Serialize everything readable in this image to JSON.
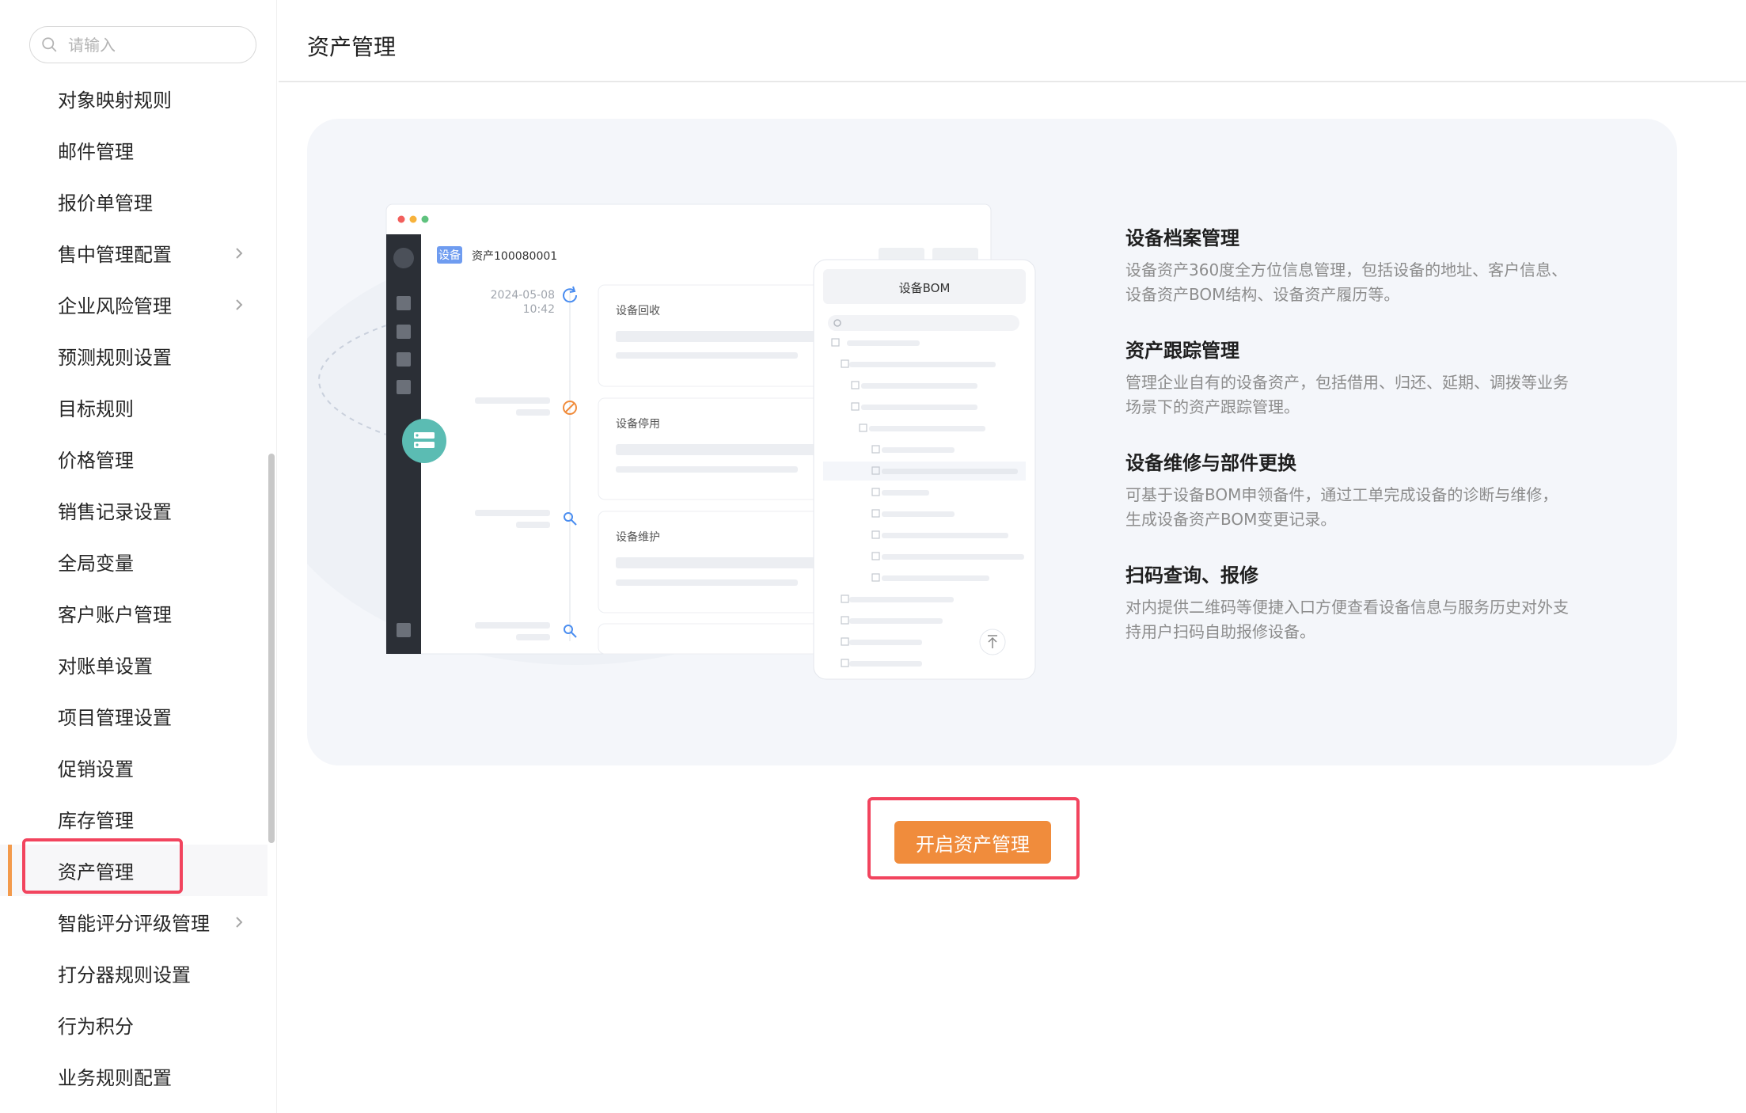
{
  "search": {
    "placeholder": "请输入"
  },
  "sidebar": {
    "items": [
      {
        "label": "对象映射规则",
        "has_submenu": false
      },
      {
        "label": "邮件管理",
        "has_submenu": false
      },
      {
        "label": "报价单管理",
        "has_submenu": false
      },
      {
        "label": "售中管理配置",
        "has_submenu": true
      },
      {
        "label": "企业风险管理",
        "has_submenu": true
      },
      {
        "label": "预测规则设置",
        "has_submenu": false
      },
      {
        "label": "目标规则",
        "has_submenu": false
      },
      {
        "label": "价格管理",
        "has_submenu": false
      },
      {
        "label": "销售记录设置",
        "has_submenu": false
      },
      {
        "label": "全局变量",
        "has_submenu": false
      },
      {
        "label": "客户账户管理",
        "has_submenu": false
      },
      {
        "label": "对账单设置",
        "has_submenu": false
      },
      {
        "label": "项目管理设置",
        "has_submenu": false
      },
      {
        "label": "促销设置",
        "has_submenu": false
      },
      {
        "label": "库存管理",
        "has_submenu": false
      },
      {
        "label": "资产管理",
        "has_submenu": false,
        "active": true
      },
      {
        "label": "智能评分评级管理",
        "has_submenu": true
      },
      {
        "label": "打分器规则设置",
        "has_submenu": false
      },
      {
        "label": "行为积分",
        "has_submenu": false
      },
      {
        "label": "业务规则配置",
        "has_submenu": false
      }
    ]
  },
  "header": {
    "title": "资产管理"
  },
  "illustration": {
    "tag": "设备",
    "asset_no": "资产100080001",
    "date": "2024-05-08",
    "time": "10:42",
    "events": [
      "设备回收",
      "设备停用",
      "设备维护"
    ],
    "bom_title": "设备BOM"
  },
  "features": [
    {
      "title": "设备档案管理",
      "desc": "设备资产360度全方位信息管理，包括设备的地址、客户信息、设备资产BOM结构、设备资产履历等。"
    },
    {
      "title": "资产跟踪管理",
      "desc": "管理企业自有的设备资产，包括借用、归还、延期、调拨等业务场景下的资产跟踪管理。"
    },
    {
      "title": "设备维修与部件更换",
      "desc": "可基于设备BOM申领备件，通过工单完成设备的诊断与维修，生成设备资产BOM变更记录。"
    },
    {
      "title": "扫码查询、报修",
      "desc": "对内提供二维码等便捷入口方便查看设备信息与服务历史对外支持用户扫码自助报修设备。"
    }
  ],
  "action": {
    "label": "开启资产管理"
  },
  "colors": {
    "accent": "#f08c3c",
    "highlight": "#f2445e",
    "teal": "#5bbcb3",
    "tag_blue": "#6f9cf0"
  },
  "icons": [
    "search-icon",
    "chevron-right-icon",
    "refresh-icon",
    "ban-icon",
    "wrench-icon",
    "back-to-top-icon",
    "server-icon"
  ]
}
